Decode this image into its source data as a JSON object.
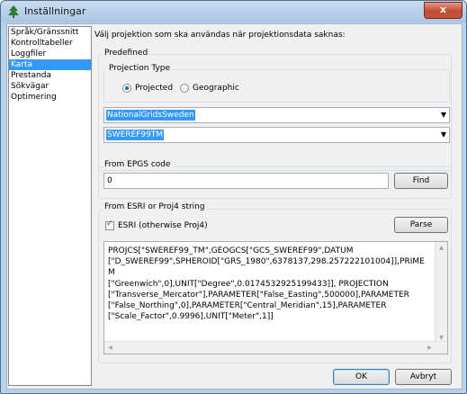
{
  "window": {
    "title": "Inställningar"
  },
  "titlebar": {
    "close_glyph": "x"
  },
  "sidebar": {
    "items": [
      {
        "label": "Språk/Gränssnitt",
        "selected": false
      },
      {
        "label": "Kontrolltabeller",
        "selected": false
      },
      {
        "label": "Loggfiler",
        "selected": false
      },
      {
        "label": "Karta",
        "selected": true
      },
      {
        "label": "Prestanda",
        "selected": false
      },
      {
        "label": "Sökvägar",
        "selected": false
      },
      {
        "label": "Optimering",
        "selected": false
      }
    ]
  },
  "main": {
    "prompt": "Välj projektion som ska användas när projektionsdata saknas:",
    "predefined": {
      "label": "Predefined",
      "projection_type": {
        "label": "Projection Type",
        "options": [
          {
            "label": "Projected",
            "checked": true
          },
          {
            "label": "Geographic",
            "checked": false
          }
        ]
      },
      "grid_combo_value": "NationalGridsSweden",
      "crs_combo_value": "SWEREF99TM"
    },
    "epsg": {
      "label": "From EPGS code",
      "input_value": "0",
      "find_label": "Find"
    },
    "esri": {
      "label": "From ESRI or Proj4 string",
      "checkbox_label": "ESRI (otherwise Proj4)",
      "checkbox_checked": true,
      "parse_label": "Parse",
      "text": "PROJCS[\"SWEREF99_TM\",GEOGCS[\"GCS_SWEREF99\",DATUM\n[\"D_SWEREF99\",SPHEROID[\"GRS_1980\",6378137,298.257222101004]],PRIMEM\n[\"Greenwich\",0],UNIT[\"Degree\",0.0174532925199433]], PROJECTION\n[\"Transverse_Mercator\"],PARAMETER[\"False_Easting\",500000],PARAMETER\n[\"False_Northing\",0],PARAMETER[\"Central_Meridian\",15],PARAMETER\n[\"Scale_Factor\",0.9996],UNIT[\"Meter\",1]]"
    }
  },
  "footer": {
    "ok_label": "OK",
    "cancel_label": "Avbryt"
  },
  "icons": {
    "app": "tree-icon",
    "close": "close-icon",
    "dropdown": "chevron-down-icon",
    "check": "check-icon"
  },
  "colors": {
    "selection": "#3399ff",
    "title_bar": "#b9d1ea",
    "close_button": "#c24b33"
  }
}
